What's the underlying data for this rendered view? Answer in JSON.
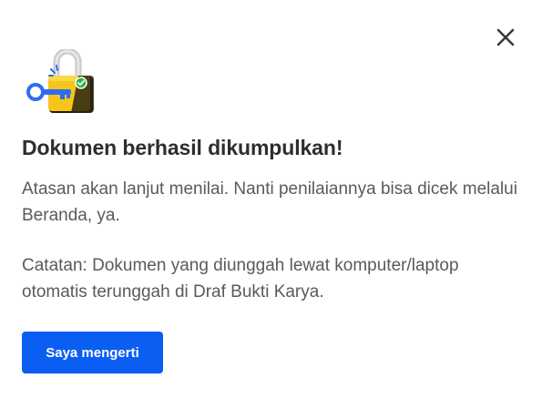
{
  "dialog": {
    "close_icon": "close-icon",
    "illustration_icon": "unlocked-padlock-with-key-icon",
    "title": "Dokumen berhasil dikumpulkan!",
    "body_paragraph_1": "Atasan akan lanjut menilai. Nanti penilaiannya bisa dicek melalui Beranda, ya.",
    "body_paragraph_2": "Catatan: Dokumen yang diunggah lewat komputer/laptop otomatis terunggah di Draf Bukti Karya.",
    "confirm_button_label": "Saya mengerti"
  },
  "colors": {
    "primary_button": "#0a5ef2",
    "title_text": "#2e2e2e",
    "body_text": "#5a5a5a",
    "key_blue": "#2f6cf6",
    "lock_yellow": "#f5c518",
    "check_green": "#2fb24c"
  }
}
